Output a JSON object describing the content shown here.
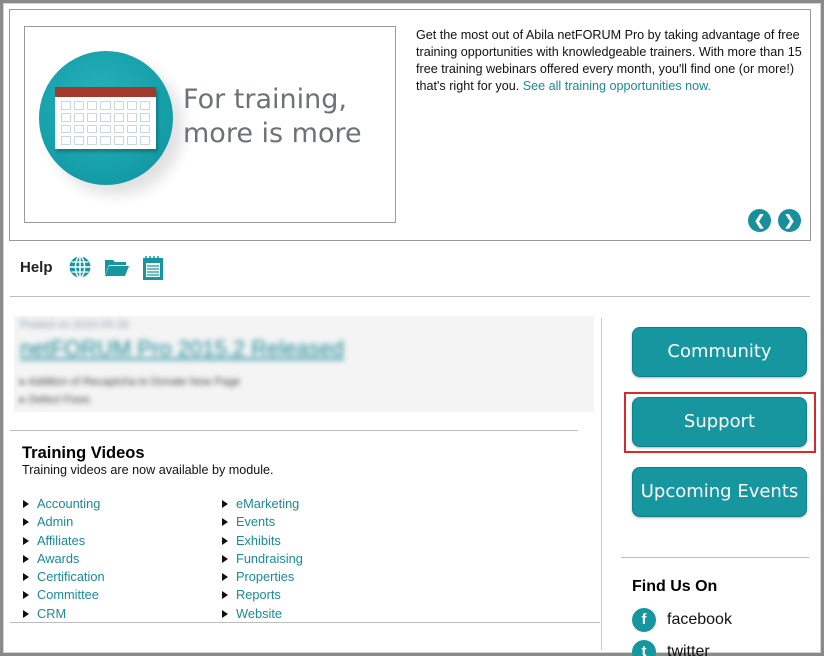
{
  "banner": {
    "promo_line1": "For training,",
    "promo_line2": "more is more",
    "blurb_text": "Get the most out of Abila netFORUM Pro by taking advantage of free training opportunities with knowledgeable trainers. With more than 15 free training webinars offered every month, you'll find one (or more!) that's right for you. ",
    "blurb_link": "See all training opportunities now.",
    "prev_icon": "arrow-left-icon",
    "next_icon": "arrow-right-icon"
  },
  "help": {
    "label": "Help",
    "icons": [
      "globe-icon",
      "folder-icon",
      "notepad-icon"
    ]
  },
  "news": {
    "date": "Posted on 2015-05-26",
    "title": "netFORUM Pro 2015.2 Released",
    "bullets": [
      "Addition of Recaptcha to Donate Now Page",
      "Defect Fixes"
    ]
  },
  "training": {
    "title": "Training Videos",
    "subtitle": "Training videos are now available by module.",
    "col1": [
      "Accounting",
      "Admin",
      "Affiliates",
      "Awards",
      "Certification",
      "Committee",
      "CRM"
    ],
    "col2": [
      "eMarketing",
      "Events",
      "Exhibits",
      "Fundraising",
      "Properties",
      "Reports",
      "Website"
    ]
  },
  "sidebar": {
    "community": "Community",
    "support": "Support",
    "upcoming": "Upcoming Events",
    "find_title": "Find Us On",
    "facebook": "facebook",
    "twitter": "twitter"
  },
  "colors": {
    "accent": "#16969f",
    "link": "#1a8a98",
    "highlight": "#d62b2b"
  }
}
